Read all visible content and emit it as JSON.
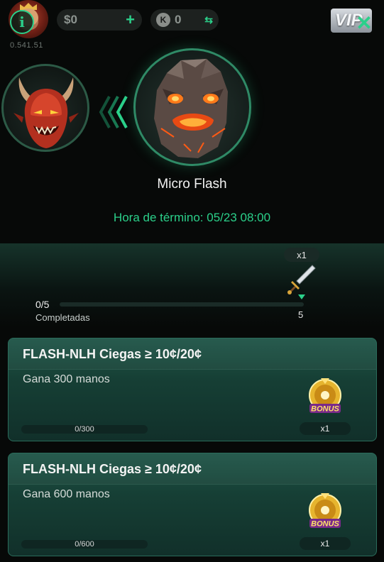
{
  "header": {
    "player_id": "0.541.51",
    "balance": "$0",
    "add_label": "+",
    "k_icon_label": "K",
    "k_value": "0",
    "swap_label": "⇆",
    "vip_label": "VIP",
    "close_label": "✕",
    "info_label": "i"
  },
  "boss": {
    "name": "Micro Flash",
    "end_time": "Hora de término: 05/23 08:00"
  },
  "progress": {
    "multiplier": "x1",
    "count": "0/5",
    "label": "Completadas",
    "target": "5",
    "fraction": 0
  },
  "tasks": [
    {
      "title": "FLASH-NLH Ciegas ≥ 10¢/20¢",
      "description": "Gana 300 manos",
      "progress_text": "0/300",
      "fraction": 0,
      "reward_label": "BONUS",
      "reward_multiplier": "x1"
    },
    {
      "title": "FLASH-NLH Ciegas ≥ 10¢/20¢",
      "description": "Gana 600 manos",
      "progress_text": "0/600",
      "fraction": 0,
      "reward_label": "BONUS",
      "reward_multiplier": "x1"
    }
  ],
  "colors": {
    "accent": "#2bd08a",
    "background": "#070908",
    "card": "#1f5547"
  }
}
